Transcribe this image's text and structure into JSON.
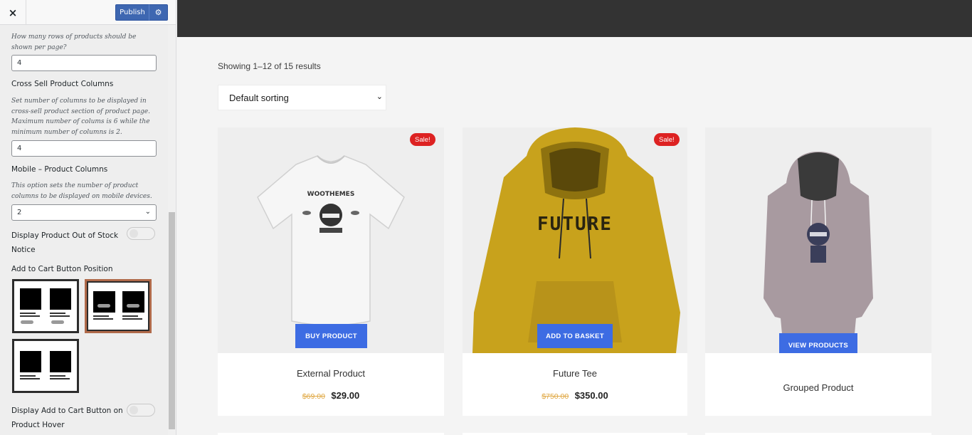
{
  "customizer": {
    "close_icon": "×",
    "publish_label": "Publish",
    "gear_icon": "⚙",
    "rows_description": "How many rows of products should be shown per page?",
    "rows_value": "4",
    "cross_sell_title": "Cross Sell Product Columns",
    "cross_sell_description": "Set number of columns to be displayed in cross-sell product section of product page. Maximum number of colums is 6 while the minimum number of columns is 2.",
    "cross_sell_value": "4",
    "mobile_title": "Mobile – Product Columns",
    "mobile_description": "This option sets the number of product columns to be displayed on mobile devices.",
    "mobile_value": "2",
    "out_of_stock_label": "Display Product Out of Stock Notice",
    "out_of_stock_enabled": false,
    "cart_position_title": "Add to Cart Button Position",
    "cart_position_selected": 2,
    "cart_hover_label": "Display Add to Cart Button on Product Hover",
    "cart_hover_enabled": false
  },
  "shop": {
    "results_text": "Showing 1–12 of 15 results",
    "sorting_value": "Default sorting",
    "products": [
      {
        "name": "External Product",
        "badge": "Sale!",
        "button": "BUY PRODUCT",
        "old_price": "$69.00",
        "price": "$29.00",
        "image": "white-tshirt"
      },
      {
        "name": "Future Tee",
        "badge": "Sale!",
        "button": "ADD TO BASKET",
        "old_price": "$750.00",
        "price": "$350.00",
        "image": "yellow-hoodie",
        "print": "FUTURE"
      },
      {
        "name": "Grouped Product",
        "button": "VIEW PRODUCTS",
        "image": "grey-hoodie"
      }
    ],
    "tshirt_print": "WOOTHEMES"
  },
  "colors": {
    "accent": "#3d6ce3",
    "publish": "#3e67b1",
    "sale": "#dd2222",
    "old_price": "#e0a844",
    "topbar": "#333333"
  }
}
